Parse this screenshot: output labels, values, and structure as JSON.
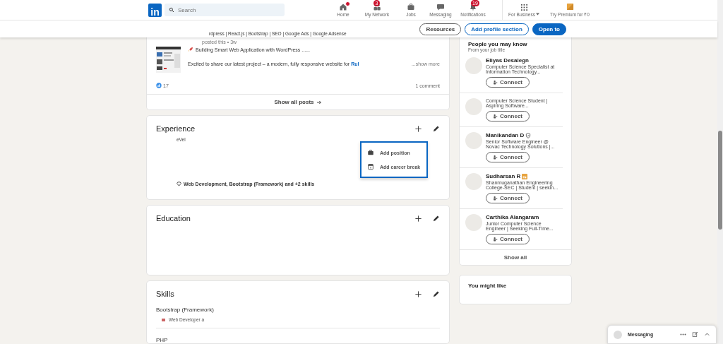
{
  "nav": {
    "logo": "in",
    "search": {
      "placeholder": "Search"
    },
    "items": [
      {
        "label": "Home",
        "kind": "home",
        "dot": true
      },
      {
        "label": "My Network",
        "kind": "network",
        "badge": "3",
        "dot": false
      },
      {
        "label": "Jobs",
        "kind": "jobs",
        "dot": false
      },
      {
        "label": "Messaging",
        "kind": "messaging",
        "dot": false
      },
      {
        "label": "Notifications",
        "kind": "bell",
        "badge": "19",
        "dot": false
      }
    ],
    "business": "For Business",
    "premium": "Try Premium for ₹0"
  },
  "profile_bar": {
    "headline": "rdpress | React.js | Bootstrap | SEO | Google Ads | Google Adsense",
    "buttons": [
      {
        "label": "Resources",
        "kind": "outline"
      },
      {
        "label": "Add profile section",
        "kind": "outline-blue"
      },
      {
        "label": "Open to",
        "kind": "primary"
      }
    ]
  },
  "posts": {
    "meta": "posted this • 3w",
    "title": "Building Smart Web Application with WordPress ......",
    "body": "Excited to share our latest project – a modern, fully responsive website for",
    "link": "Rul",
    "show_more": "...show more",
    "reactions": "17",
    "comments": "1 comment",
    "show_all": "Show all posts"
  },
  "experience": {
    "title": "Experience",
    "fragment": "eVel",
    "skills": "Web Development, Bootstrap (Framework) and +2 skills",
    "menu": [
      {
        "label": "Add position",
        "kind": "briefcase"
      },
      {
        "label": "Add career break",
        "kind": "calendar"
      }
    ]
  },
  "education": {
    "title": "Education"
  },
  "skills": {
    "title": "Skills",
    "items": [
      {
        "name": "Bootstrap (Framework)",
        "detail": "Web Developer a"
      },
      {
        "name": "PHP"
      }
    ]
  },
  "people": {
    "title": "People you may know",
    "subtitle": "From your job title",
    "items": [
      {
        "name": "Eliyas Desalegn",
        "verified": false,
        "premium": false,
        "headline": "Computer Science Specialist at Information Technology...",
        "connect": "Connect"
      },
      {
        "verified": false,
        "premium": false,
        "headline": "Computer Science Student | Aspiring Software...",
        "connect": "Connect"
      },
      {
        "name": "Manikandan D",
        "verified": true,
        "premium": false,
        "headline": "Senior Software Engineer @ Novac Technology Solutions |...",
        "connect": "Connect"
      },
      {
        "name": "Sudharsan R",
        "verified": false,
        "premium": true,
        "headline": "Shanmuganathan Engineering College-SEC | Student | seekin...",
        "connect": "Connect"
      },
      {
        "name": "Carthika Alangaram",
        "verified": false,
        "premium": false,
        "headline": "Junior Computer Science Engineer | Seeking Full-Time...",
        "connect": "Connect"
      }
    ],
    "show_all": "Show all"
  },
  "might_like": {
    "title": "You might like"
  },
  "messaging": {
    "label": "Messaging"
  }
}
